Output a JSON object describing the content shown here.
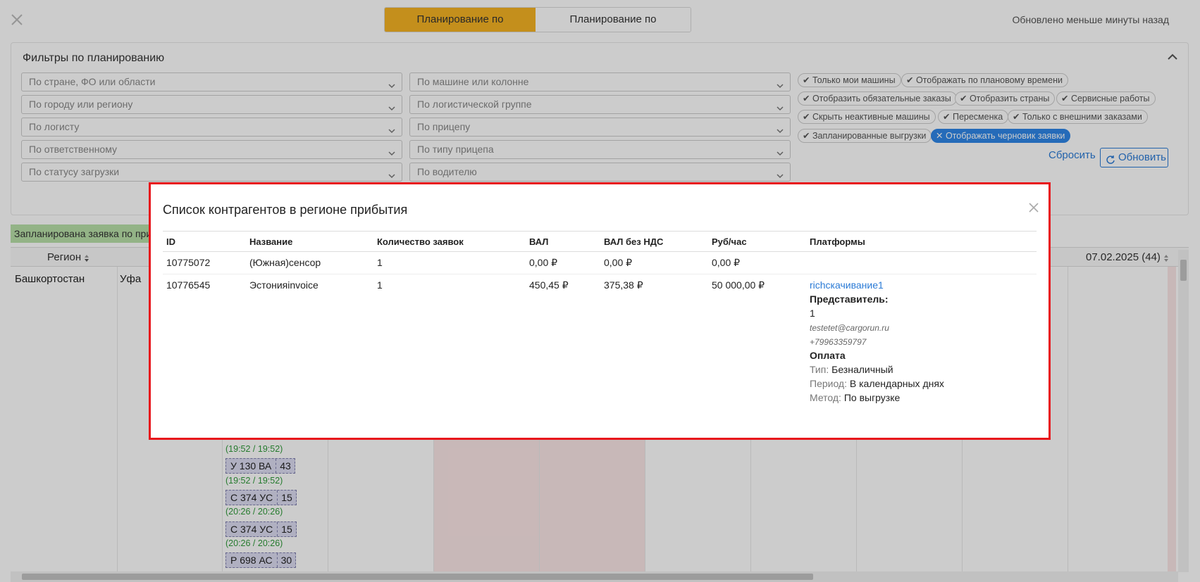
{
  "header": {
    "tab_cities": "Планирование по городам",
    "tab_vehicles": "Планирование по машинам",
    "updated": "Обновлено меньше минуты назад"
  },
  "filters": {
    "title": "Фильтры по планированию",
    "left": [
      "По стране, ФО или области",
      "По городу или региону",
      "По логисту",
      "По ответственному",
      "По статусу загрузки"
    ],
    "middle": [
      "По машине или колонне",
      "По логистической группе",
      "По прицепу",
      "По типу прицепа",
      "По водителю"
    ],
    "chips": [
      "Только мои машины",
      "Отображать по плановому времени",
      "Отобразить обязательные заказы",
      "Отобразить страны",
      "Сервисные работы",
      "Скрыть неактивные машины",
      "Пересменка",
      "Только с внешними заказами",
      "Запланированные выгрузки",
      "Отображать черновик заявки"
    ],
    "reset": "Сбросить",
    "refresh": "Обновить"
  },
  "grid": {
    "green_bar": "Запланирована заявка по при",
    "col_region": "Регион",
    "col_date": "07.02.2025 (44)",
    "region": "Башкортостан",
    "city": "Уфа",
    "vehicles": [
      {
        "time": "(19:52 / 19:52)"
      },
      {
        "plate": "У 130 ВА",
        "num": "43",
        "time": "(19:52 / 19:52)"
      },
      {
        "plate": "С 374 УС",
        "num": "15",
        "time": "(20:26 / 20:26)"
      },
      {
        "plate": "С 374 УС",
        "num": "15",
        "time": "(20:26 / 20:26)"
      },
      {
        "plate": "Р 698 АС",
        "num": "30"
      }
    ]
  },
  "modal": {
    "title": "Список контрагентов в регионе прибытия",
    "columns": [
      "ID",
      "Название",
      "Количество заявок",
      "ВАЛ",
      "ВАЛ без НДС",
      "Руб/час",
      "Платформы"
    ],
    "rows": [
      {
        "id": "10775072",
        "name": "(Южная)сенсор",
        "count": "1",
        "val": "0,00 ₽",
        "val_no_vat": "0,00 ₽",
        "rub_hour": "0,00 ₽"
      },
      {
        "id": "10776545",
        "name": "Эстонияinvoice",
        "count": "1",
        "val": "450,45 ₽",
        "val_no_vat": "375,38 ₽",
        "rub_hour": "50 000,00 ₽"
      }
    ],
    "platform": {
      "link": "richскачивание1",
      "rep_label": "Представитель:",
      "rep_value": "1",
      "email": "testetet@cargorun.ru",
      "phone": "+79963359797",
      "payment_label": "Оплата",
      "type_label": "Тип:",
      "type_value": "Безналичный",
      "period_label": "Период:",
      "period_value": "В календарных днях",
      "method_label": "Метод:",
      "method_value": "По выгрузке"
    }
  }
}
